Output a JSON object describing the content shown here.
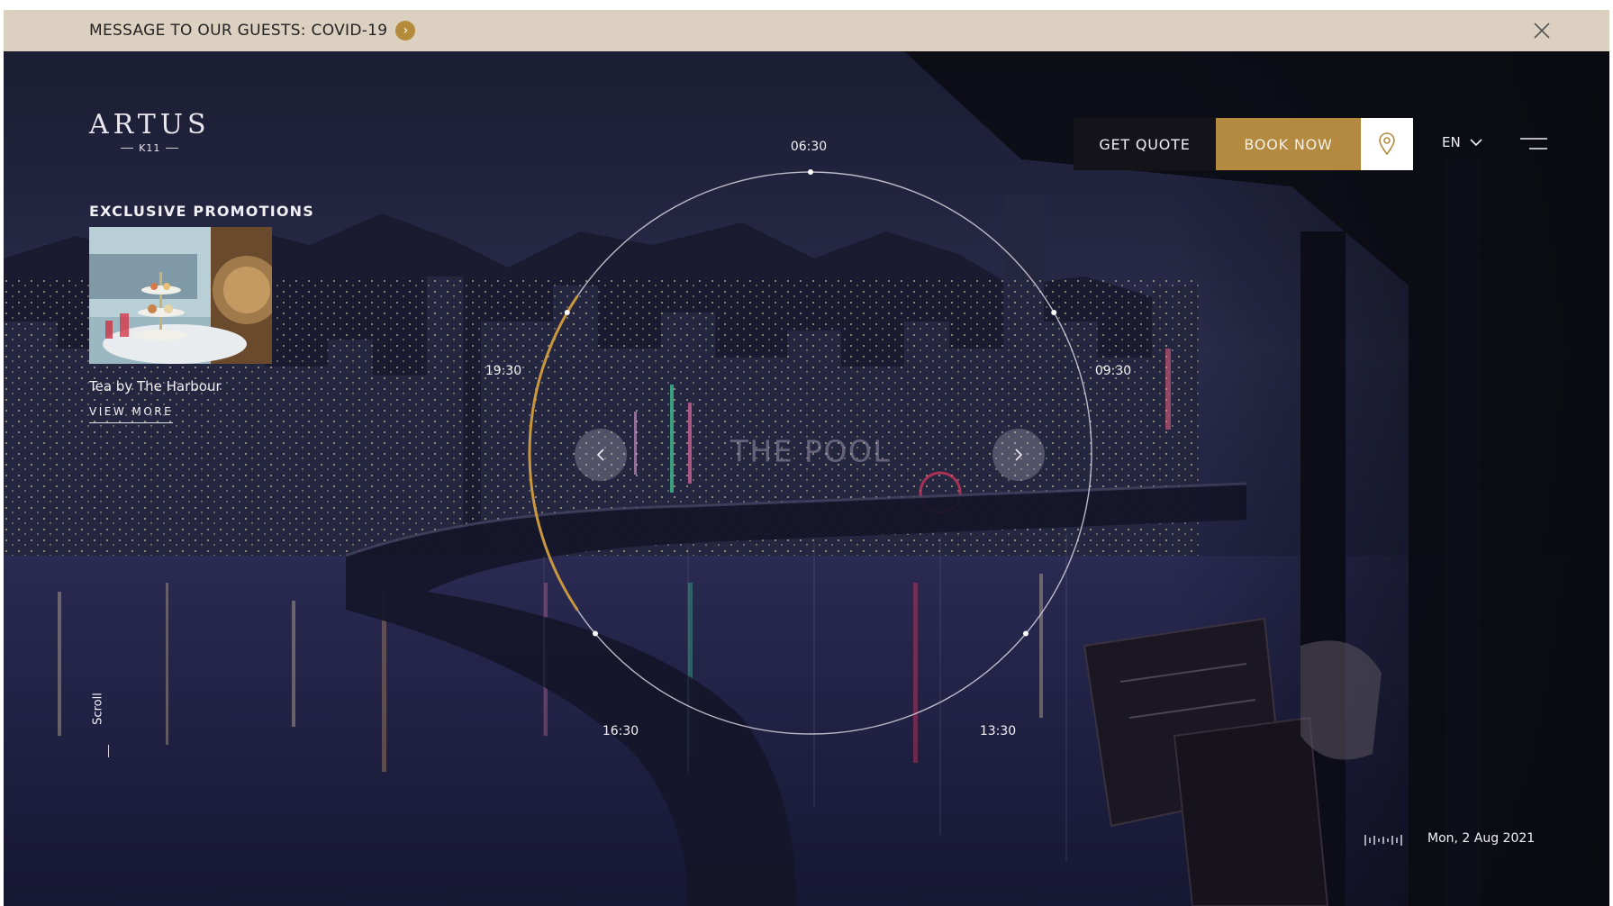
{
  "banner": {
    "message": "MESSAGE TO OUR GUESTS: COVID-19"
  },
  "logo": {
    "name": "ARTUS",
    "subtitle": "K11"
  },
  "promotions": {
    "heading": "EXCLUSIVE PROMOTIONS",
    "item_title": "Tea by The Harbour",
    "link_label": "VIEW MORE"
  },
  "header": {
    "quote_label": "GET QUOTE",
    "book_label": "BOOK NOW",
    "map_icon": "map-pin-icon",
    "language": "EN",
    "menu_icon": "hamburger-menu-icon"
  },
  "dial": {
    "venue_title": "THE POOL",
    "times": [
      "06:30",
      "09:30",
      "13:30",
      "16:30",
      "19:30"
    ],
    "active_segment": "19:30",
    "accent_color": "#c9983e"
  },
  "footer": {
    "scroll_label": "Scroll",
    "sound_icon": "sound-bars-icon",
    "date": "Mon, 2 Aug 2021"
  },
  "colors": {
    "banner_bg": "#dcd0c0",
    "book_button": "#b38a3f",
    "quote_button": "#141319",
    "night_sky": "#1f2242"
  }
}
